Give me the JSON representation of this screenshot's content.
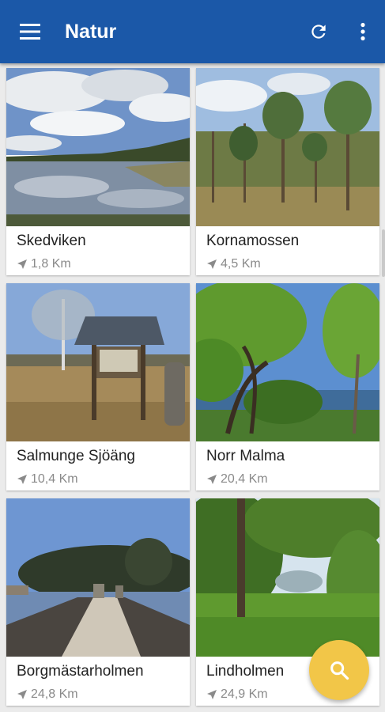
{
  "app_bar": {
    "title": "Natur",
    "menu_icon": "hamburger-menu-icon",
    "refresh_icon": "refresh-icon",
    "overflow_icon": "more-vertical-icon",
    "color": "#1b58a8"
  },
  "places": [
    {
      "name": "Skedviken",
      "distance": "1,8 Km"
    },
    {
      "name": "Kornamossen",
      "distance": "4,5 Km"
    },
    {
      "name": "Salmunge Sjöäng",
      "distance": "10,4 Km"
    },
    {
      "name": "Norr Malma",
      "distance": "20,4 Km"
    },
    {
      "name": "Borgmästarholmen",
      "distance": "24,8 Km"
    },
    {
      "name": "Lindholmen",
      "distance": "24,9 Km"
    }
  ],
  "fab": {
    "icon": "search-icon",
    "color": "#f2c648"
  },
  "location_icon": "navigation-arrow-icon"
}
